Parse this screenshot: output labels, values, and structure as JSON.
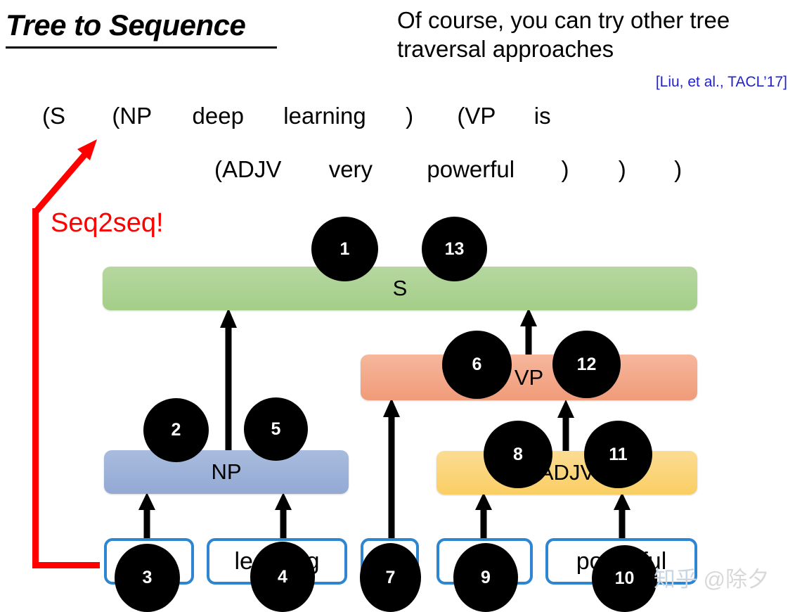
{
  "slide": {
    "title": "Tree to Sequence",
    "note": "Of course, you can try other tree traversal approaches",
    "citation": "[Liu, et al., TACL’17]",
    "seq2seq_label": "Seq2seq!",
    "watermark_logo": "知乎",
    "watermark_handle": "@除夕"
  },
  "colors": {
    "s_bar": "#A9D18E",
    "vp_bar": "#F4A582",
    "np_bar": "#9DB4DC",
    "adjv_bar": "#FBD171",
    "word_box_border": "#2E86D0",
    "arrow_red": "#FF0000",
    "arrow_black": "#000000",
    "node_fill": "#000000",
    "citation_color": "#2222CC"
  },
  "linearized": {
    "row1": [
      "(S",
      "(NP",
      "deep",
      "learning",
      ")",
      "(VP",
      "is"
    ],
    "row2": [
      "(ADJV",
      "very",
      "powerful",
      ")",
      ")",
      ")"
    ]
  },
  "tree": {
    "bars": [
      {
        "id": "s",
        "label": "S"
      },
      {
        "id": "vp",
        "label": "VP"
      },
      {
        "id": "np",
        "label": "NP"
      },
      {
        "id": "adjv",
        "label": "ADJV"
      }
    ],
    "words": [
      {
        "id": "deep",
        "label": "deep"
      },
      {
        "id": "learning",
        "label": "learning"
      },
      {
        "id": "is",
        "label": "is"
      },
      {
        "id": "very",
        "label": "very"
      },
      {
        "id": "powerful",
        "label": "powerful"
      }
    ],
    "traversal_nodes": [
      {
        "n": "1",
        "attached_to": "S"
      },
      {
        "n": "2",
        "attached_to": "NP"
      },
      {
        "n": "3",
        "attached_to": "deep"
      },
      {
        "n": "4",
        "attached_to": "learning"
      },
      {
        "n": "5",
        "attached_to": "NP"
      },
      {
        "n": "6",
        "attached_to": "VP"
      },
      {
        "n": "7",
        "attached_to": "is"
      },
      {
        "n": "8",
        "attached_to": "ADJV"
      },
      {
        "n": "9",
        "attached_to": "very"
      },
      {
        "n": "10",
        "attached_to": "powerful"
      },
      {
        "n": "11",
        "attached_to": "ADJV"
      },
      {
        "n": "12",
        "attached_to": "VP"
      },
      {
        "n": "13",
        "attached_to": "S"
      }
    ]
  }
}
